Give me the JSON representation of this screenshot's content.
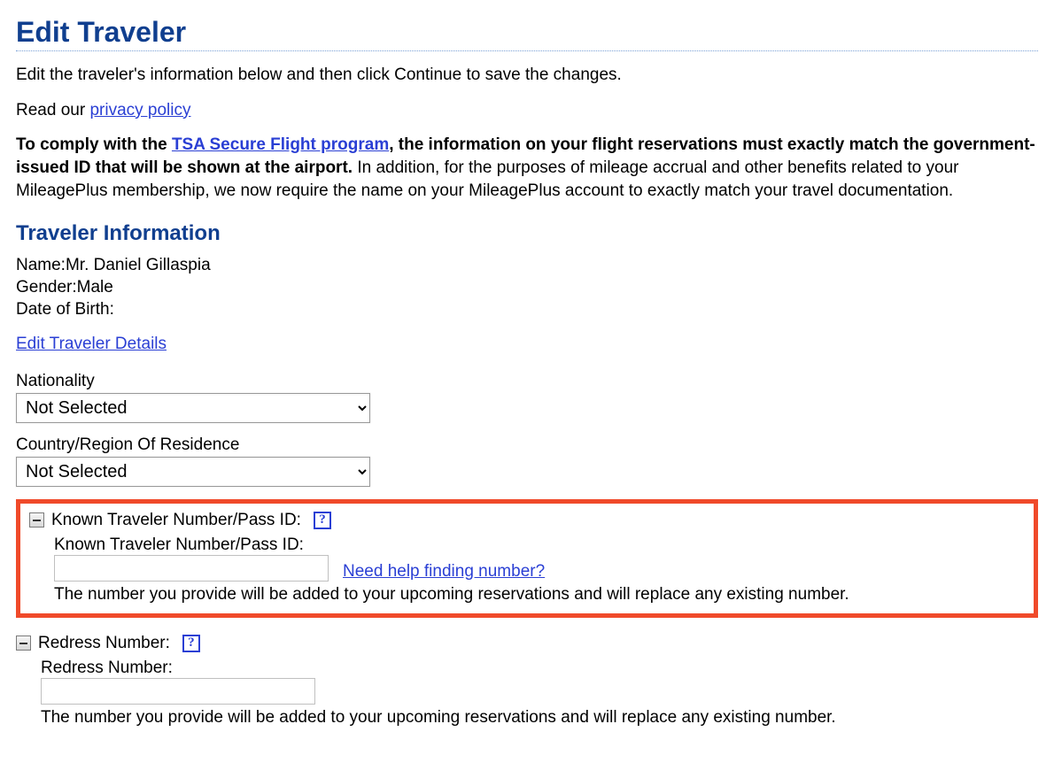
{
  "page": {
    "title": "Edit Traveler"
  },
  "intro": "Edit the traveler's information below and then click Continue to save the changes.",
  "privacy": {
    "prefix": "Read our ",
    "link": "privacy policy"
  },
  "tsa": {
    "lead_bold_pre": "To comply with the ",
    "link": "TSA Secure Flight program",
    "lead_bold_post": ", the information on your flight reservations must exactly match the government-issued ID that will be shown at the airport.",
    "rest": " In addition, for the purposes of mileage accrual and other benefits related to your MileagePlus membership, we now require the name on your MileagePlus account to exactly match your travel documentation."
  },
  "section": {
    "title": "Traveler Information"
  },
  "info": {
    "name_label": "Name:",
    "name_value": "Mr. Daniel Gillaspia",
    "gender_label": "Gender:",
    "gender_value": "Male",
    "dob_label": "Date of Birth:",
    "dob_value": ""
  },
  "edit_link": "Edit Traveler Details",
  "nationality": {
    "label": "Nationality",
    "selected": "Not Selected"
  },
  "country": {
    "label": "Country/Region Of Residence",
    "selected": "Not Selected"
  },
  "ktn": {
    "header": "Known Traveler Number/Pass ID:",
    "field_label": "Known Traveler Number/Pass ID:",
    "value": "",
    "help_link": "Need help finding number?",
    "note": "The number you provide will be added to your upcoming reservations and will replace any existing number."
  },
  "redress": {
    "header": "Redress Number:",
    "field_label": "Redress Number:",
    "value": "",
    "note": "The number you provide will be added to your upcoming reservations and will replace any existing number."
  },
  "icons": {
    "help_glyph": "?"
  }
}
